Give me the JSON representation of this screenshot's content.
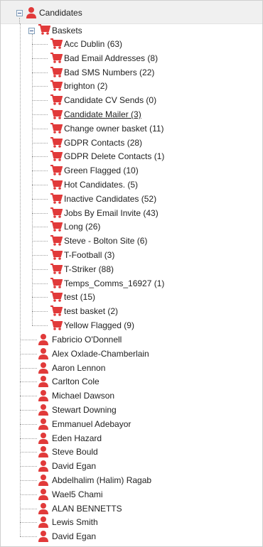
{
  "colors": {
    "icon_red": "#e13a3a",
    "selected_bg": "#dcdcdc",
    "header_bg": "#f0f0f0"
  },
  "root": {
    "label": "Candidates",
    "icon": "person-icon",
    "expanded": true
  },
  "baskets": {
    "label": "Baskets",
    "icon": "cart-icon",
    "expanded": true,
    "items": [
      {
        "label": "Acc Dublin (63)"
      },
      {
        "label": "Bad Email Addresses (8)"
      },
      {
        "label": "Bad SMS Numbers (22)"
      },
      {
        "label": "brighton (2)"
      },
      {
        "label": "Candidate CV Sends (0)"
      },
      {
        "label": "Candidate Mailer (3)",
        "selected": true
      },
      {
        "label": "Change owner basket (11)"
      },
      {
        "label": "GDPR Contacts (28)"
      },
      {
        "label": "GDPR Delete Contacts (1)"
      },
      {
        "label": "Green Flagged (10)"
      },
      {
        "label": "Hot Candidates. (5)"
      },
      {
        "label": "Inactive Candidates (52)"
      },
      {
        "label": "Jobs By Email Invite (43)"
      },
      {
        "label": "Long (26)"
      },
      {
        "label": "Steve - Bolton Site (6)"
      },
      {
        "label": "T-Football (3)"
      },
      {
        "label": "T-Striker (88)"
      },
      {
        "label": "Temps_Comms_16927 (1)"
      },
      {
        "label": "test (15)"
      },
      {
        "label": "test basket (2)"
      },
      {
        "label": "Yellow Flagged (9)"
      }
    ]
  },
  "candidates": [
    {
      "label": "Fabricio O'Donnell"
    },
    {
      "label": "Alex Oxlade-Chamberlain"
    },
    {
      "label": "Aaron Lennon"
    },
    {
      "label": "Carlton Cole"
    },
    {
      "label": "Michael Dawson"
    },
    {
      "label": "Stewart Downing"
    },
    {
      "label": "Emmanuel Adebayor"
    },
    {
      "label": "Eden Hazard"
    },
    {
      "label": "Steve Bould"
    },
    {
      "label": "David Egan"
    },
    {
      "label": "Abdelhalim (Halim) Ragab"
    },
    {
      "label": "Wael5 Chami"
    },
    {
      "label": "ALAN BENNETTS"
    },
    {
      "label": "Lewis Smith"
    },
    {
      "label": "David Egan"
    }
  ]
}
